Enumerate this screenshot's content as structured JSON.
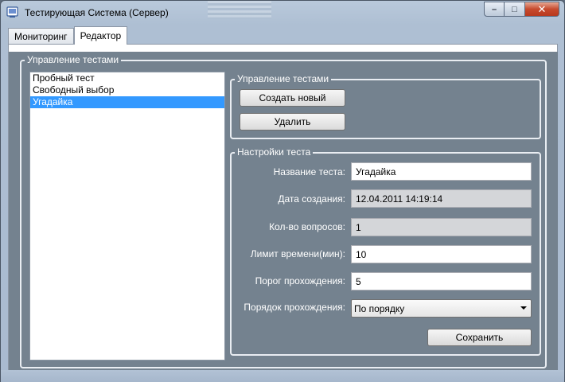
{
  "window": {
    "title": "Тестирующая Система (Сервер)",
    "min_glyph": "–",
    "max_glyph": "□",
    "close_glyph": "✕"
  },
  "tabs": [
    {
      "label": "Мониторинг",
      "active": false
    },
    {
      "label": "Редактор",
      "active": true
    }
  ],
  "test_management": {
    "title": "Управление тестами",
    "tests": [
      "Пробный тест",
      "Свободный выбор",
      "Угадайка"
    ],
    "selected_index": 2
  },
  "actions": {
    "title": "Управление тестами",
    "create_label": "Создать новый",
    "delete_label": "Удалить"
  },
  "settings": {
    "title": "Настройки теста",
    "name_label": "Название теста:",
    "name_value": "Угадайка",
    "date_label": "Дата создания:",
    "date_value": "12.04.2011 14:19:14",
    "questions_label": "Кол-во вопросов:",
    "questions_value": "1",
    "time_label": "Лимит времени(мин):",
    "time_value": "10",
    "threshold_label": "Порог прохождения:",
    "threshold_value": "5",
    "order_label": "Порядок прохождения:",
    "order_value": "По порядку",
    "save_label": "Сохранить"
  }
}
